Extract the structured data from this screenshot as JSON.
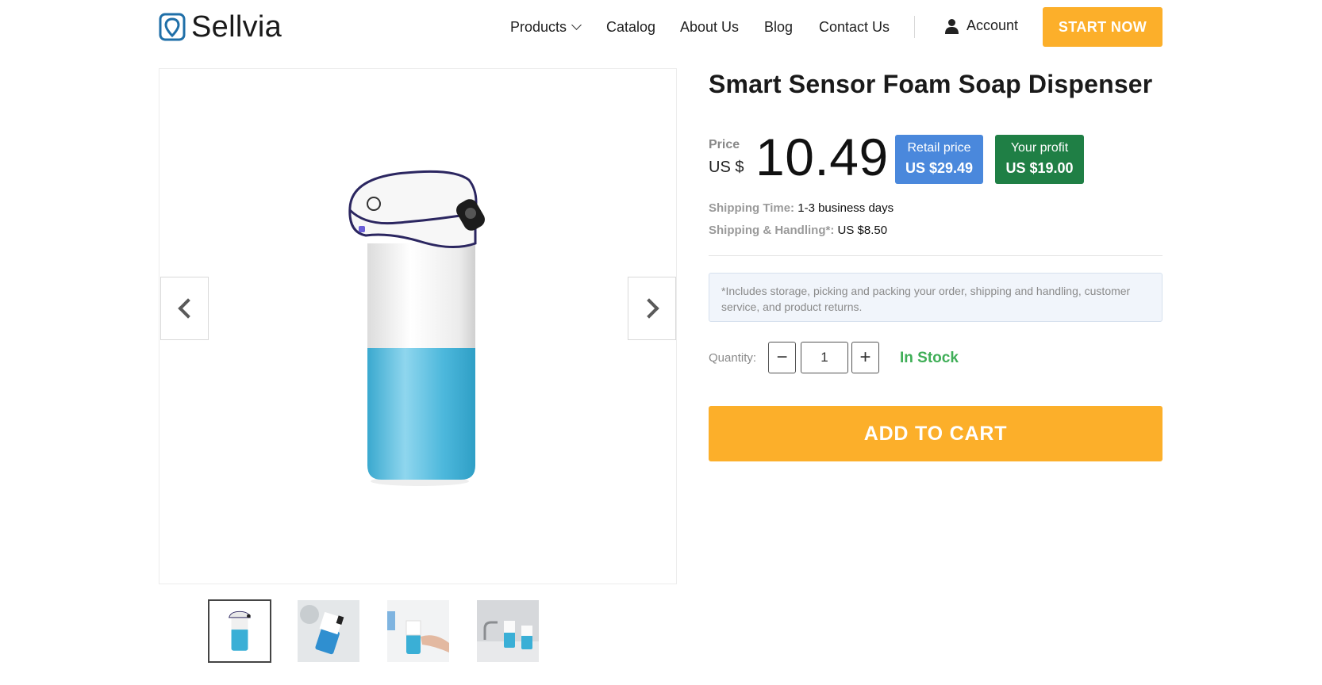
{
  "brand": {
    "name": "Sellvia",
    "accent": "#1f6fa8"
  },
  "nav": {
    "items": [
      {
        "label": "Products",
        "has_dropdown": true
      },
      {
        "label": "Catalog"
      },
      {
        "label": "About Us"
      },
      {
        "label": "Blog"
      },
      {
        "label": "Contact Us"
      }
    ],
    "account_label": "Account",
    "cta_label": "START NOW",
    "cta_color": "#fcaf2a"
  },
  "gallery": {
    "prev_icon": "chevron-left-icon",
    "next_icon": "chevron-right-icon",
    "thumbnails_count": 4,
    "active_index": 0
  },
  "product": {
    "title": "Smart Sensor Foam Soap Dispenser",
    "price_label": "Price",
    "currency": "US $",
    "price": "10.49",
    "retail": {
      "label": "Retail price",
      "value": "US $29.49",
      "color": "#4a88dc"
    },
    "profit": {
      "label": "Your profit",
      "value": "US $19.00",
      "color": "#1f7f45"
    },
    "shipping_time_label": "Shipping Time:",
    "shipping_time_value": "1-3 business days",
    "shipping_handling_label": "Shipping & Handling*:",
    "shipping_handling_value": "US $8.50",
    "note": "*Includes storage, picking and packing your order, shipping and handling, customer service, and product returns.",
    "quantity_label": "Quantity:",
    "quantity_value": "1",
    "minus_label": "−",
    "plus_label": "+",
    "stock_status": "In Stock",
    "stock_color": "#3fae57",
    "add_to_cart_label": "ADD TO CART"
  }
}
